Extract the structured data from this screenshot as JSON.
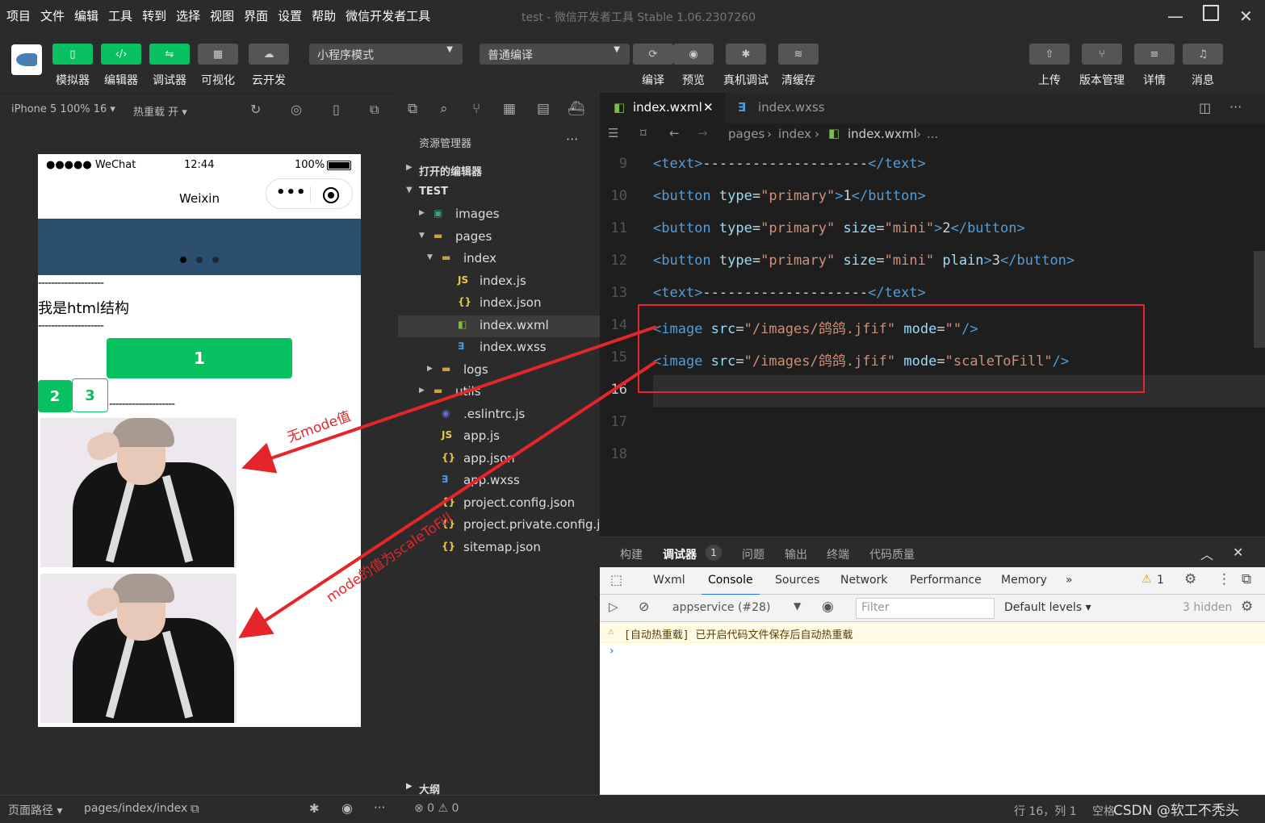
{
  "menu": [
    "项目",
    "文件",
    "编辑",
    "工具",
    "转到",
    "选择",
    "视图",
    "界面",
    "设置",
    "帮助",
    "微信开发者工具"
  ],
  "window_title": "test - 微信开发者工具 Stable 1.06.2307260",
  "toolbar": {
    "left_labels": [
      "模拟器",
      "编辑器",
      "调试器",
      "可视化",
      "云开发"
    ],
    "mode_select": "小程序模式",
    "compile_select": "普通编译",
    "mid_labels": [
      "编译",
      "预览",
      "真机调试",
      "清缓存"
    ],
    "right_labels": [
      "上传",
      "版本管理",
      "详情",
      "消息"
    ]
  },
  "simulator": {
    "device": "iPhone 5 100% 16 ▾",
    "hot_reload": "热重载 开 ▾",
    "status_carrier": "●●●●● WeChat",
    "status_time": "12:44",
    "status_battery": "100%",
    "nav_title": "Weixin",
    "dash_line": "--------------------",
    "html_text": "我是html结构",
    "btn1": "1",
    "btn2": "2",
    "btn3": "3"
  },
  "explorer": {
    "title": "资源管理器",
    "more": "···",
    "open_editors": "打开的编辑器",
    "project": "TEST",
    "items": [
      {
        "name": "images",
        "icon": "folder-image"
      },
      {
        "name": "pages",
        "icon": "folder"
      },
      {
        "name": "index",
        "icon": "folder"
      },
      {
        "name": "index.js",
        "icon": "js"
      },
      {
        "name": "index.json",
        "icon": "json"
      },
      {
        "name": "index.wxml",
        "icon": "wxml"
      },
      {
        "name": "index.wxss",
        "icon": "wxss"
      },
      {
        "name": "logs",
        "icon": "folder"
      },
      {
        "name": "utils",
        "icon": "folder"
      },
      {
        "name": ".eslintrc.js",
        "icon": "eslint"
      },
      {
        "name": "app.js",
        "icon": "js"
      },
      {
        "name": "app.json",
        "icon": "json"
      },
      {
        "name": "app.wxss",
        "icon": "wxss"
      },
      {
        "name": "project.config.json",
        "icon": "json"
      },
      {
        "name": "project.private.config.js...",
        "icon": "json"
      },
      {
        "name": "sitemap.json",
        "icon": "json"
      }
    ],
    "outline": "大纲"
  },
  "editor": {
    "tabs": [
      "index.wxml",
      "index.wxss"
    ],
    "breadcrumb": [
      "pages",
      "index",
      "index.wxml",
      "..."
    ],
    "line_numbers": [
      "9",
      "10",
      "11",
      "12",
      "13",
      "14",
      "15",
      "16",
      "17",
      "18"
    ],
    "lines": [
      [
        {
          "c": "tg",
          "t": "<text>"
        },
        {
          "c": "tx",
          "t": "--------------------"
        },
        {
          "c": "tg",
          "t": "</text>"
        }
      ],
      [
        {
          "c": "tg",
          "t": "<button "
        },
        {
          "c": "at",
          "t": "type"
        },
        {
          "c": "tx",
          "t": "="
        },
        {
          "c": "st",
          "t": "\"primary\""
        },
        {
          "c": "tg",
          "t": ">"
        },
        {
          "c": "tx",
          "t": "1"
        },
        {
          "c": "tg",
          "t": "</button>"
        }
      ],
      [
        {
          "c": "tg",
          "t": "<button "
        },
        {
          "c": "at",
          "t": "type"
        },
        {
          "c": "tx",
          "t": "="
        },
        {
          "c": "st",
          "t": "\"primary\""
        },
        {
          "c": "tx",
          "t": " "
        },
        {
          "c": "at",
          "t": "size"
        },
        {
          "c": "tx",
          "t": "="
        },
        {
          "c": "st",
          "t": "\"mini\""
        },
        {
          "c": "tg",
          "t": ">"
        },
        {
          "c": "tx",
          "t": "2"
        },
        {
          "c": "tg",
          "t": "</button>"
        }
      ],
      [
        {
          "c": "tg",
          "t": "<button "
        },
        {
          "c": "at",
          "t": "type"
        },
        {
          "c": "tx",
          "t": "="
        },
        {
          "c": "st",
          "t": "\"primary\""
        },
        {
          "c": "tx",
          "t": " "
        },
        {
          "c": "at",
          "t": "size"
        },
        {
          "c": "tx",
          "t": "="
        },
        {
          "c": "st",
          "t": "\"mini\""
        },
        {
          "c": "tx",
          "t": " "
        },
        {
          "c": "at",
          "t": "plain"
        },
        {
          "c": "tg",
          "t": ">"
        },
        {
          "c": "tx",
          "t": "3"
        },
        {
          "c": "tg",
          "t": "</button>"
        }
      ],
      [
        {
          "c": "tg",
          "t": "<text>"
        },
        {
          "c": "tx",
          "t": "--------------------"
        },
        {
          "c": "tg",
          "t": "</text>"
        }
      ],
      [
        {
          "c": "tg",
          "t": "<image "
        },
        {
          "c": "at",
          "t": "src"
        },
        {
          "c": "tx",
          "t": "="
        },
        {
          "c": "st",
          "t": "\"/images/鸽鸽.jfif\""
        },
        {
          "c": "tx",
          "t": " "
        },
        {
          "c": "at",
          "t": "mode"
        },
        {
          "c": "tx",
          "t": "="
        },
        {
          "c": "st",
          "t": "\"\""
        },
        {
          "c": "tg",
          "t": "/>"
        }
      ],
      [
        {
          "c": "tg",
          "t": "<image "
        },
        {
          "c": "at",
          "t": "src"
        },
        {
          "c": "tx",
          "t": "="
        },
        {
          "c": "st",
          "t": "\"/images/鸽鸽.jfif\""
        },
        {
          "c": "tx",
          "t": " "
        },
        {
          "c": "at",
          "t": "mode"
        },
        {
          "c": "tx",
          "t": "="
        },
        {
          "c": "st",
          "t": "\"scaleToFill\""
        },
        {
          "c": "tg",
          "t": "/>"
        }
      ],
      [],
      [],
      []
    ]
  },
  "debug": {
    "tabs": [
      "构建",
      "调试器",
      "问题",
      "输出",
      "终端",
      "代码质量"
    ],
    "badge": "1",
    "devtools_tabs": [
      "Wxml",
      "Console",
      "Sources",
      "Network",
      "Performance",
      "Memory",
      "»"
    ],
    "warn_count": "1",
    "context": "appservice (#28)",
    "filter_placeholder": "Filter",
    "levels": "Default levels ▾",
    "hidden": "3 hidden",
    "warn_message": "[自动热重载] 已开启代码文件保存后自动热重载",
    "prompt": "›"
  },
  "footer": {
    "page_path_label": "页面路径 ▾",
    "page_path": "pages/index/index",
    "errors": "⊗ 0 ⚠ 0",
    "cursor": "行 16，列 1",
    "spaces": "空格",
    "watermark": "CSDN @软工不秃头"
  },
  "annotations": {
    "no_mode": "无mode值",
    "scale_to_fill": "mode的值为scaleToFill"
  },
  "colors": {
    "accent_green": "#07c160",
    "annotation_red": "#e4262a"
  }
}
